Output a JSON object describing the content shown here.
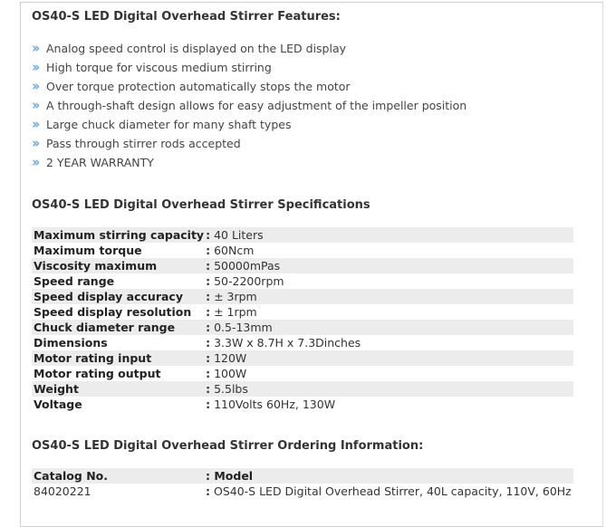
{
  "features": {
    "title": "OS40-S LED Digital Overhead Stirrer Features:",
    "items": [
      "Analog speed control is displayed on the LED display",
      "High torque for viscous medium stirring",
      "Over torque protection automatically stops the motor",
      "A through-shaft design allows for easy adjustment of the impeller position",
      "Large chuck diameter for many shaft types",
      "Pass through stirrer rods accepted",
      "2 YEAR WARRANTY"
    ]
  },
  "specs": {
    "title": "OS40-S LED Digital Overhead Stirrer Specifications",
    "rows": [
      {
        "label": "Maximum stirring capacity",
        "value": "40 Liters"
      },
      {
        "label": "Maximum torque",
        "value": "60Ncm"
      },
      {
        "label": "Viscosity maximum",
        "value": "50000mPas"
      },
      {
        "label": "Speed range",
        "value": "50-2200rpm"
      },
      {
        "label": "Speed display accuracy",
        "value": "± 3rpm"
      },
      {
        "label": "Speed display resolution",
        "value": "± 1rpm"
      },
      {
        "label": "Chuck diameter range",
        "value": "0.5-13mm"
      },
      {
        "label": "Dimensions",
        "value": "3.3W x 8.7H x 7.3Dinches"
      },
      {
        "label": "Motor rating input",
        "value": "120W"
      },
      {
        "label": "Motor rating output",
        "value": "100W"
      },
      {
        "label": "Weight",
        "value": "5.5lbs"
      },
      {
        "label": "Voltage",
        "value": "110Volts 60Hz, 130W"
      }
    ]
  },
  "ordering": {
    "title": "OS40-S LED Digital Overhead Stirrer Ordering Information:",
    "header": {
      "catalog": "Catalog No.",
      "model": "Model"
    },
    "rows": [
      {
        "catalog": "84020221",
        "model": "OS40-S LED Digital Overhead Stirrer, 40L capacity, 110V, 60Hz"
      }
    ]
  },
  "colon": ":",
  "bullet_icon": "double-chevron-icon",
  "colors": {
    "bullet": "#6fa8dc",
    "row_shade": "#ececec",
    "border": "#cfcfcf"
  }
}
